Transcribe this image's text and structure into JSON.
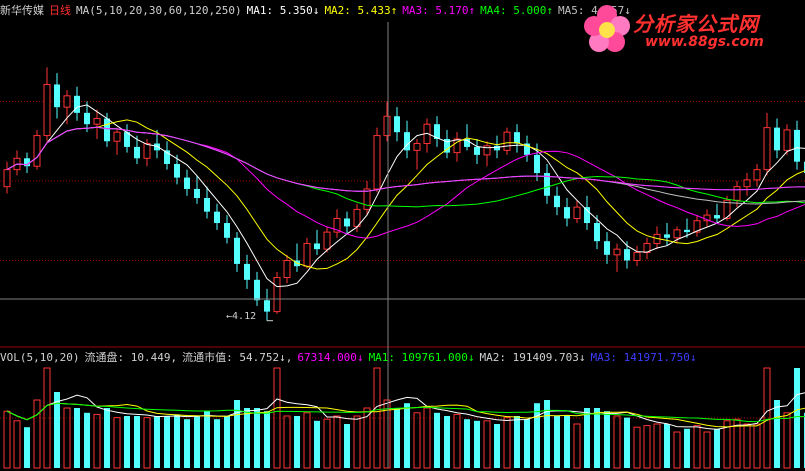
{
  "header": {
    "stock_name": "新华传媒",
    "period": "日线",
    "ma_params": "MA(5,10,20,30,60,120,250)",
    "ma1": "MA1: 5.350↓",
    "ma2": "MA2: 5.433↑",
    "ma3": "MA3: 5.170↑",
    "ma4": "MA4: 5.000↑",
    "ma5": "MA5: 4.957↓"
  },
  "volume_header": {
    "params": "VOL(5,10,20)",
    "float_shares": "流通盘: 10.449,",
    "float_mcap": "流通市值: 54.752↓,",
    "vol": "67314.000↓",
    "ma1": "MA1: 109761.000↓",
    "ma2": "MA2: 191409.703↓",
    "ma3": "MA3: 141971.750↓"
  },
  "logo": {
    "text": "分析家公式网",
    "url": "www.88gs.com"
  },
  "annotations": {
    "low_price": "4.12"
  },
  "colors": {
    "up": "#ff3232",
    "down": "#54ffff",
    "ma1": "#ffffff",
    "ma2": "#ffff00",
    "ma3": "#ff00ff",
    "ma4": "#00ff00",
    "ma5": "#c0c0c0",
    "ma6": "#3c3cff",
    "ma7": "#ff40ff",
    "grid": "#a00000",
    "name": "#d0d0d0",
    "period": "#ff3030",
    "cursor": "#808080"
  },
  "chart_data": {
    "type": "candlestick",
    "ylim": [
      3.95,
      6.75
    ],
    "low_value": 4.12,
    "candles": [
      [
        5.3,
        5.52,
        5.24,
        5.45
      ],
      [
        5.45,
        5.62,
        5.4,
        5.55
      ],
      [
        5.55,
        5.6,
        5.42,
        5.48
      ],
      [
        5.48,
        5.8,
        5.45,
        5.75
      ],
      [
        5.75,
        6.35,
        5.7,
        6.2
      ],
      [
        6.2,
        6.3,
        5.9,
        6.0
      ],
      [
        6.0,
        6.15,
        5.85,
        6.1
      ],
      [
        6.1,
        6.18,
        5.88,
        5.95
      ],
      [
        5.95,
        6.05,
        5.78,
        5.85
      ],
      [
        5.85,
        5.98,
        5.72,
        5.9
      ],
      [
        5.9,
        5.95,
        5.65,
        5.7
      ],
      [
        5.7,
        5.82,
        5.58,
        5.78
      ],
      [
        5.78,
        5.85,
        5.6,
        5.65
      ],
      [
        5.65,
        5.75,
        5.5,
        5.55
      ],
      [
        5.55,
        5.72,
        5.48,
        5.68
      ],
      [
        5.68,
        5.8,
        5.55,
        5.62
      ],
      [
        5.62,
        5.7,
        5.45,
        5.5
      ],
      [
        5.5,
        5.58,
        5.32,
        5.38
      ],
      [
        5.38,
        5.45,
        5.22,
        5.28
      ],
      [
        5.28,
        5.4,
        5.15,
        5.2
      ],
      [
        5.2,
        5.3,
        5.02,
        5.08
      ],
      [
        5.08,
        5.15,
        4.92,
        4.98
      ],
      [
        4.98,
        5.05,
        4.8,
        4.85
      ],
      [
        4.85,
        4.9,
        4.55,
        4.62
      ],
      [
        4.62,
        4.7,
        4.4,
        4.48
      ],
      [
        4.48,
        4.55,
        4.25,
        4.3
      ],
      [
        4.3,
        4.4,
        4.12,
        4.2
      ],
      [
        4.2,
        4.55,
        4.18,
        4.5
      ],
      [
        4.5,
        4.7,
        4.45,
        4.65
      ],
      [
        4.65,
        4.8,
        4.55,
        4.6
      ],
      [
        4.6,
        4.85,
        4.58,
        4.8
      ],
      [
        4.8,
        4.92,
        4.7,
        4.75
      ],
      [
        4.75,
        4.95,
        4.72,
        4.9
      ],
      [
        4.9,
        5.1,
        4.85,
        5.02
      ],
      [
        5.02,
        5.08,
        4.88,
        4.95
      ],
      [
        4.95,
        5.15,
        4.9,
        5.1
      ],
      [
        5.1,
        5.35,
        5.05,
        5.28
      ],
      [
        5.28,
        5.82,
        5.25,
        5.75
      ],
      [
        5.75,
        6.05,
        5.7,
        5.92
      ],
      [
        5.92,
        6.0,
        5.7,
        5.78
      ],
      [
        5.78,
        5.88,
        5.55,
        5.62
      ],
      [
        5.62,
        5.72,
        5.45,
        5.68
      ],
      [
        5.68,
        5.9,
        5.6,
        5.85
      ],
      [
        5.85,
        5.92,
        5.65,
        5.72
      ],
      [
        5.72,
        5.8,
        5.55,
        5.6
      ],
      [
        5.6,
        5.78,
        5.52,
        5.72
      ],
      [
        5.72,
        5.85,
        5.62,
        5.65
      ],
      [
        5.65,
        5.72,
        5.5,
        5.58
      ],
      [
        5.58,
        5.7,
        5.48,
        5.66
      ],
      [
        5.66,
        5.75,
        5.55,
        5.62
      ],
      [
        5.62,
        5.82,
        5.58,
        5.78
      ],
      [
        5.78,
        5.85,
        5.6,
        5.68
      ],
      [
        5.68,
        5.75,
        5.52,
        5.58
      ],
      [
        5.58,
        5.68,
        5.35,
        5.42
      ],
      [
        5.42,
        5.5,
        5.15,
        5.22
      ],
      [
        5.22,
        5.3,
        5.05,
        5.12
      ],
      [
        5.12,
        5.2,
        4.95,
        5.02
      ],
      [
        5.02,
        5.18,
        4.98,
        5.12
      ],
      [
        5.12,
        5.22,
        4.92,
        4.98
      ],
      [
        4.98,
        5.05,
        4.75,
        4.82
      ],
      [
        4.82,
        4.9,
        4.62,
        4.7
      ],
      [
        4.7,
        4.8,
        4.55,
        4.75
      ],
      [
        4.75,
        4.82,
        4.58,
        4.65
      ],
      [
        4.65,
        4.78,
        4.6,
        4.72
      ],
      [
        4.72,
        4.85,
        4.66,
        4.8
      ],
      [
        4.8,
        4.95,
        4.75,
        4.88
      ],
      [
        4.88,
        4.98,
        4.78,
        4.85
      ],
      [
        4.85,
        4.95,
        4.8,
        4.92
      ],
      [
        4.92,
        5.02,
        4.85,
        4.9
      ],
      [
        4.9,
        5.05,
        4.86,
        5.0
      ],
      [
        5.0,
        5.1,
        4.95,
        5.05
      ],
      [
        5.05,
        5.15,
        4.98,
        5.02
      ],
      [
        5.02,
        5.22,
        5.0,
        5.18
      ],
      [
        5.18,
        5.35,
        5.12,
        5.3
      ],
      [
        5.3,
        5.42,
        5.22,
        5.36
      ],
      [
        5.36,
        5.5,
        5.3,
        5.45
      ],
      [
        5.45,
        5.95,
        5.4,
        5.82
      ],
      [
        5.82,
        5.9,
        5.55,
        5.62
      ],
      [
        5.62,
        5.85,
        5.58,
        5.8
      ],
      [
        5.8,
        5.88,
        5.45,
        5.52
      ],
      [
        5.52,
        5.62,
        5.35,
        5.42
      ]
    ]
  }
}
